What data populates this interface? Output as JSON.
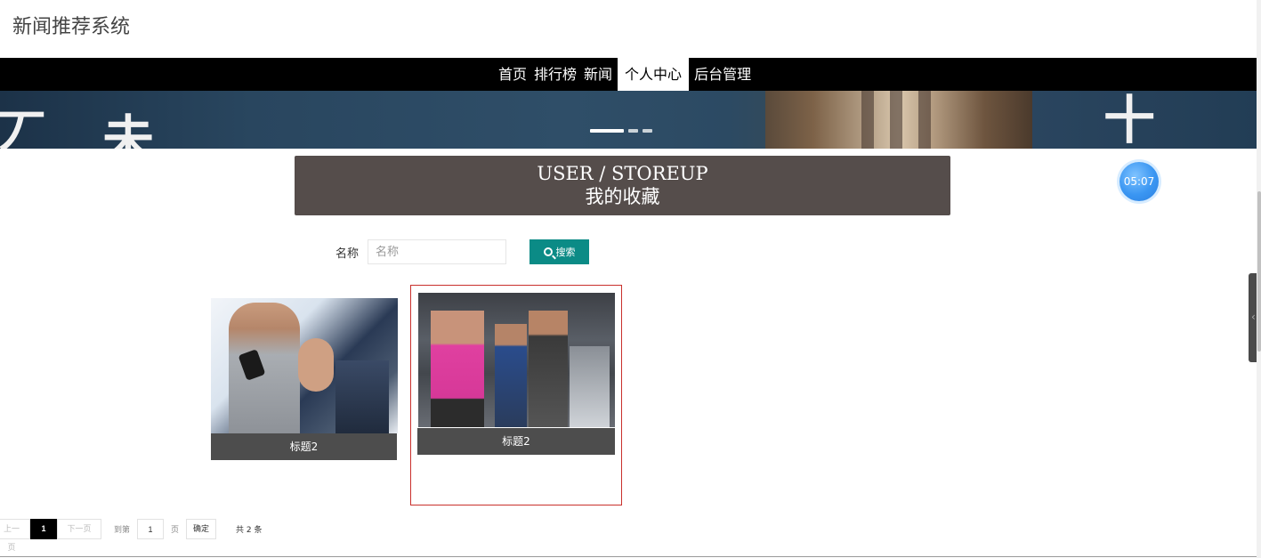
{
  "site": {
    "title": "新闻推荐系统"
  },
  "nav": {
    "items": [
      {
        "label": "首页",
        "active": false
      },
      {
        "label": "排行榜",
        "active": false
      },
      {
        "label": "新闻",
        "active": false
      },
      {
        "label": "个人中心",
        "active": true
      },
      {
        "label": "后台管理",
        "active": false
      }
    ]
  },
  "banner": {
    "slide_count": 3,
    "active_slide": 1
  },
  "timer": {
    "text": "05:07",
    "color": "#3a96f2"
  },
  "header": {
    "title_en": "USER / STOREUP",
    "title_zh": "我的收藏",
    "background": "#554d4b"
  },
  "search": {
    "label": "名称",
    "placeholder": "名称",
    "value": "",
    "button_label": "搜索",
    "button_color": "#0b8b86"
  },
  "cards": [
    {
      "caption": "标题2",
      "image": "cycling-class-photo"
    },
    {
      "caption": "标题2",
      "image": "gym-elliptical-photo",
      "highlighted": true
    }
  ],
  "pagination": {
    "prev_label": "上一页",
    "current_page": "1",
    "next_label": "下一页",
    "goto_label": "到第",
    "page_input_value": "1",
    "page_unit": "页",
    "confirm_label": "确定",
    "total_text": "共 2 条"
  }
}
